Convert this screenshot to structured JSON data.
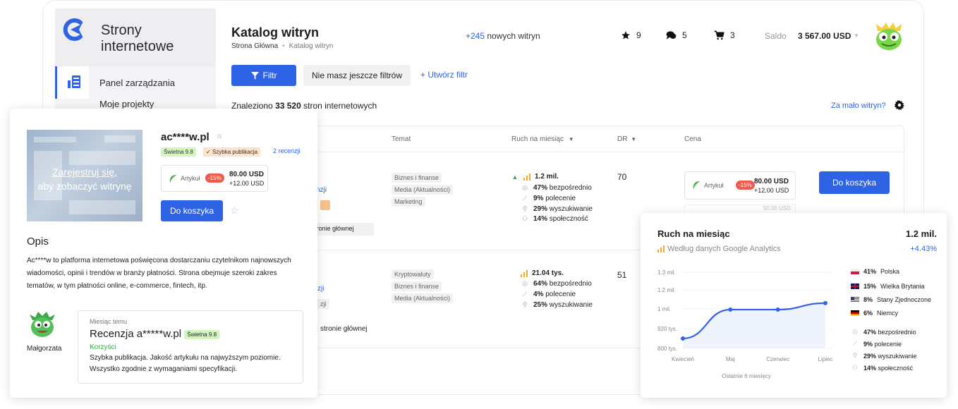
{
  "sidebar": {
    "title": "Strony internetowe",
    "items": [
      {
        "label": "Panel zarządzania"
      },
      {
        "label": "Moje projekty"
      }
    ]
  },
  "header": {
    "title": "Katalog witryn",
    "breadcrumb": [
      "Strona Główna",
      "Katalog witryn"
    ],
    "new_sites_count": "+245",
    "new_sites_label": "nowych witryn",
    "counters": {
      "favorites": "9",
      "messages": "5",
      "cart": "3"
    },
    "saldo_label": "Saldo",
    "saldo_value": "3 567.00 USD"
  },
  "filters": {
    "filter_button": "Filtr",
    "no_filters": "Nie masz jeszcze filtrów",
    "create_filter": "+ Utwórz filtr"
  },
  "results": {
    "found_prefix": "Znaleziono",
    "found_count": "33 520",
    "found_suffix": "stron internetowych",
    "too_few": "Za mało witryn?"
  },
  "table": {
    "headers": {
      "topic": "Temat",
      "traffic": "Ruch na miesiąc",
      "dr": "DR",
      "price": "Cena"
    },
    "rows": [
      {
        "topics": [
          "Biznes i finanse",
          "Media (Aktualności)",
          "Marketing"
        ],
        "traffic": "1.2 mil.",
        "sources": [
          {
            "pct": "47%",
            "label": "bezpośrednio"
          },
          {
            "pct": "9%",
            "label": "polecenie"
          },
          {
            "pct": "29%",
            "label": "wyszukiwanie"
          },
          {
            "pct": "14%",
            "label": "społeczność"
          }
        ],
        "dr": "70",
        "partial_link": "nzji",
        "partial_box": "a stronie głównej",
        "price_label": "Artykuł",
        "discount": "-15%",
        "price": "80.00 USD",
        "extra": "+12.00 USD",
        "ghost": "50.00 USD",
        "cart_button": "Do koszyka"
      },
      {
        "topics": [
          "Kryptowaluty",
          "Biznes i finanse",
          "Media (Aktualności)"
        ],
        "traffic": "21.04 tys.",
        "sources": [
          {
            "pct": "64%",
            "label": "bezpośrednio"
          },
          {
            "pct": "4%",
            "label": "polecenie"
          },
          {
            "pct": "25%",
            "label": "wyszukiwanie"
          }
        ],
        "dr": "51",
        "partial_link": "zji",
        "partial_tag": "zji",
        "partial_text": "stronie głównej"
      }
    ]
  },
  "site_popup": {
    "thumb_line1": "Zarejestruj się,",
    "thumb_line2": "aby zobaczyć witrynę",
    "site_name": "ac****w.pl",
    "rating_badge": "Świetna 9.8",
    "fast_badge": "Szybka publikacja",
    "reviews": "2 recenzji",
    "price_label": "Artykuł",
    "discount": "-15%",
    "price": "80.00 USD",
    "extra": "+12.00 USD",
    "cart_button": "Do koszyka",
    "desc_title": "Opis",
    "desc": "Ac****w to platforma internetowa poświęcona dostarczaniu czytelnikom najnowszych wiadomości, opinii i trendów w branży płatności. Strona obejmuje szeroki zakres tematów, w tym płatności online, e-commerce, fintech, itp.",
    "review": {
      "user": "Małgorzata",
      "time": "Miesiąc temu",
      "title": "Recenzja a*****w.pl",
      "badge": "Świetna 9.8",
      "pros_label": "Korzyści",
      "text": "Szybka publikacja. Jakość artykułu na najwyższym poziomie. Wszystko zgodnie z wymaganiami specyfikacji."
    }
  },
  "traffic_popup": {
    "title": "Ruch na miesiąc",
    "total": "1.2 mil.",
    "subtitle": "Według danych Google Analytics",
    "growth": "+4.43%",
    "countries": [
      {
        "pct": "41%",
        "name": "Polska",
        "flag_colors": [
          "#ffffff",
          "#dc143c"
        ]
      },
      {
        "pct": "15%",
        "name": "Wielka Brytania",
        "flag_colors": [
          "#012169",
          "#c8102e"
        ]
      },
      {
        "pct": "8%",
        "name": "Stany Zjednoczone",
        "flag_colors": [
          "#3c3b6e",
          "#b22234"
        ]
      },
      {
        "pct": "6%",
        "name": "Niemcy",
        "flag_colors": [
          "#000000",
          "#dd0000",
          "#ffce00"
        ]
      }
    ],
    "sources": [
      {
        "pct": "47%",
        "label": "bezpośrednio"
      },
      {
        "pct": "9%",
        "label": "polecenie"
      },
      {
        "pct": "29%",
        "label": "wyszukiwanie"
      },
      {
        "pct": "14%",
        "label": "społeczność"
      }
    ]
  },
  "chart_data": {
    "type": "line",
    "categories": [
      "Kwiecień",
      "Maj",
      "Czerwiec",
      "Lipiec"
    ],
    "values": [
      860000,
      997000,
      997000,
      1060000
    ],
    "y_ticks": [
      "1.3 mil.",
      "1.2 mil.",
      "1 mil.",
      "920 tys.",
      "800 tys."
    ],
    "xlabel": "Ostatnie 6 miesięcy",
    "color": "#3461e8"
  },
  "colors": {
    "accent": "#2f63e6",
    "discount": "#ef5a4a",
    "success": "#3aa94a",
    "rating_badge_bg": "#d4f5c0"
  }
}
